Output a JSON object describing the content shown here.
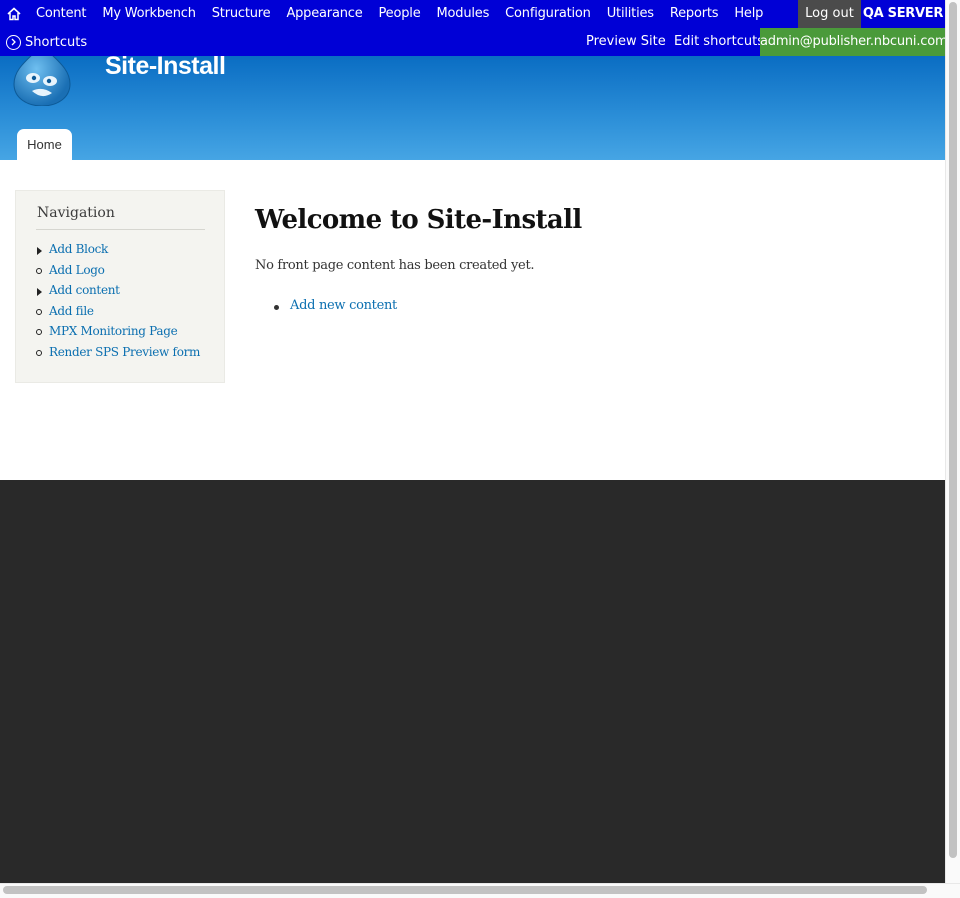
{
  "toolbar": {
    "menu": [
      "Content",
      "My Workbench",
      "Structure",
      "Appearance",
      "People",
      "Modules",
      "Configuration",
      "Utilities",
      "Reports",
      "Help"
    ],
    "logout": "Log out",
    "server_label": "QA SERVER",
    "shortcuts": "Shortcuts",
    "preview_site": "Preview Site",
    "edit_shortcuts": "Edit shortcuts",
    "user_email": "admin@publisher.nbcuni.com",
    "colors": {
      "bar": "#0000d6",
      "logout_bg": "#4b4b4b",
      "user_bg": "#4a9a3a"
    }
  },
  "header": {
    "site_name": "Site-Install",
    "tabs": [
      "Home"
    ],
    "logo_icon": "drupal-drop-icon"
  },
  "sidebar": {
    "title": "Navigation",
    "items": [
      {
        "label": "Add Block",
        "bullet": "triangle"
      },
      {
        "label": "Add Logo",
        "bullet": "circle"
      },
      {
        "label": "Add content",
        "bullet": "triangle"
      },
      {
        "label": "Add file",
        "bullet": "circle"
      },
      {
        "label": "MPX Monitoring Page",
        "bullet": "circle"
      },
      {
        "label": "Render SPS Preview form",
        "bullet": "circle"
      }
    ]
  },
  "main": {
    "title": "Welcome to Site-Install",
    "intro": "No front page content has been created yet.",
    "links": [
      "Add new content"
    ]
  },
  "colors": {
    "link": "#0b6fb0",
    "footer": "#292929"
  }
}
